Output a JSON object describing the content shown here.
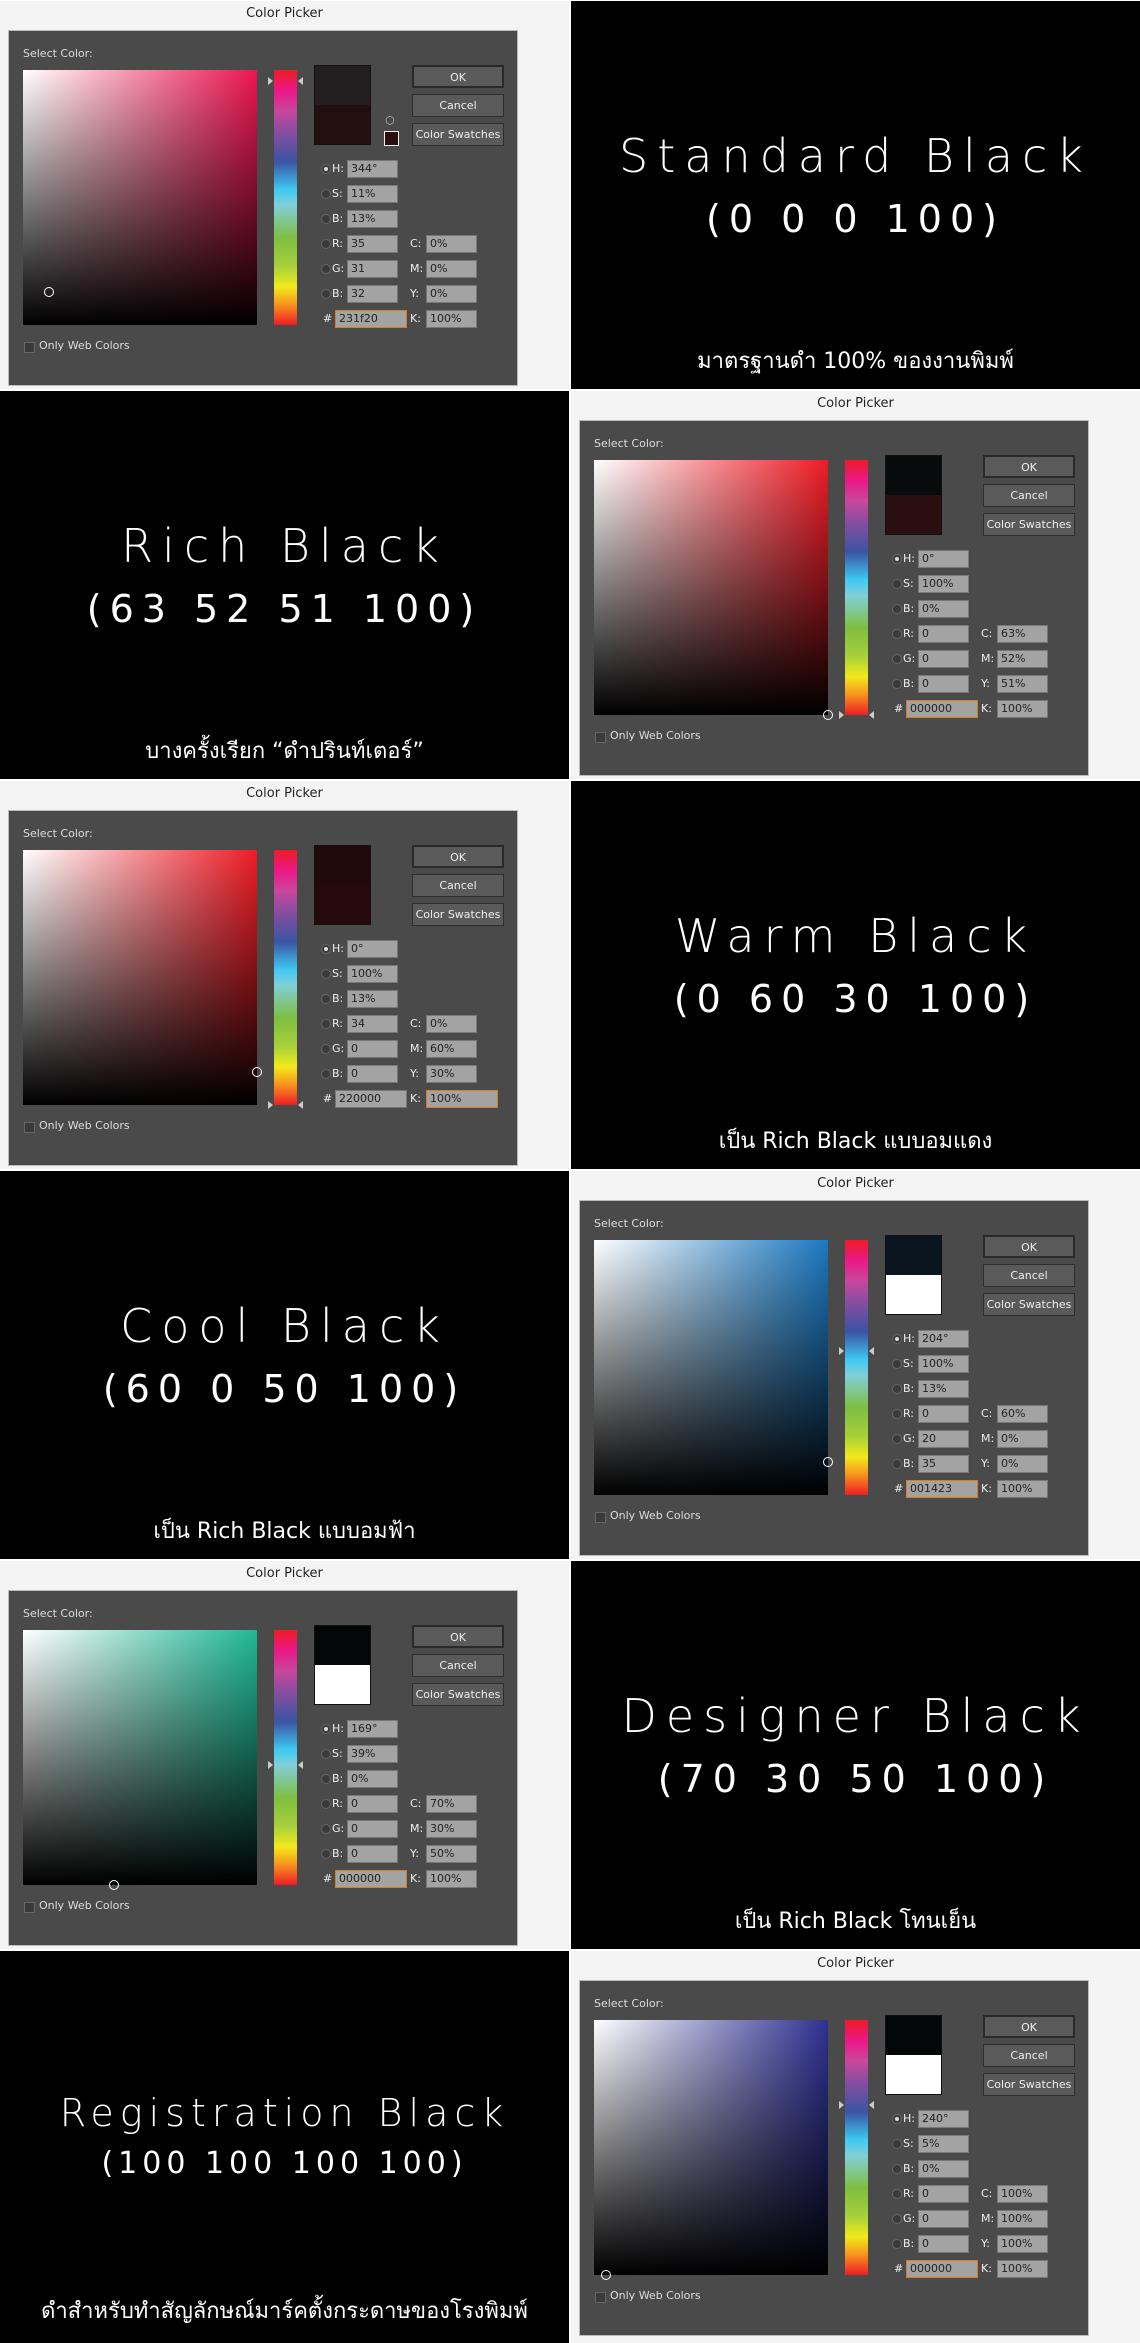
{
  "dialog_common": {
    "title": "Color Picker",
    "select_label": "Select Color:",
    "ok": "OK",
    "cancel": "Cancel",
    "swatches": "Color Swatches",
    "only_web": "Only Web Colors",
    "labels": {
      "h": "H:",
      "s": "S:",
      "b": "B:",
      "r": "R:",
      "g": "G:",
      "bl": "B:",
      "hex": "#",
      "c": "C:",
      "m": "M:",
      "y": "Y:",
      "k": "K:"
    }
  },
  "rows": [
    {
      "dialog_side": "left",
      "dialog": {
        "h": "344°",
        "s": "11%",
        "b": "13%",
        "r": "35",
        "g": "31",
        "bl": "32",
        "hex": "231f20",
        "c": "0%",
        "m": "0%",
        "y": "0%",
        "k": "100%",
        "hue_deg": 344,
        "sat": 0.11,
        "bri": 0.13,
        "new_color": "#231f20",
        "old_color": "#230e10",
        "hue_color": "#ec1550",
        "selected_field": "hex"
      },
      "text": {
        "title": "Standard Black",
        "values": "(0 0 0 100)",
        "caption": "มาตรฐานดำ 100% ของงานพิมพ์"
      }
    },
    {
      "dialog_side": "right",
      "dialog": {
        "h": "0°",
        "s": "100%",
        "b": "0%",
        "r": "0",
        "g": "0",
        "bl": "0",
        "hex": "000000",
        "c": "63%",
        "m": "52%",
        "y": "51%",
        "k": "100%",
        "hue_deg": 0,
        "sat": 1,
        "bri": 0,
        "new_color": "#070b0c",
        "old_color": "#2a0e10",
        "hue_color": "#ee1c25",
        "selected_field": "hex"
      },
      "text": {
        "title": "Rich Black",
        "values": "(63 52 51 100)",
        "caption": "บางครั้งเรียก “ดำปรินท์เตอร์”"
      }
    },
    {
      "dialog_side": "left",
      "dialog": {
        "h": "0°",
        "s": "100%",
        "b": "13%",
        "r": "34",
        "g": "0",
        "bl": "0",
        "hex": "220000",
        "c": "0%",
        "m": "60%",
        "y": "30%",
        "k": "100%",
        "hue_deg": 0,
        "sat": 1,
        "bri": 0.13,
        "new_color": "#220a0c",
        "old_color": "#26090c",
        "hue_color": "#ee1c25",
        "selected_field": "k"
      },
      "text": {
        "title": "Warm Black",
        "values": "(0 60 30 100)",
        "caption": "เป็น Rich Black แบบอมแดง"
      }
    },
    {
      "dialog_side": "right",
      "dialog": {
        "h": "204°",
        "s": "100%",
        "b": "13%",
        "r": "0",
        "g": "20",
        "bl": "35",
        "hex": "001423",
        "c": "60%",
        "m": "0%",
        "y": "0%",
        "k": "100%",
        "hue_deg": 204,
        "sat": 1,
        "bri": 0.13,
        "new_color": "#0b1520",
        "old_color": "#ffffff",
        "hue_color": "#1c78c0",
        "selected_field": "hex"
      },
      "text": {
        "title": "Cool Black",
        "values": "(60 0 50 100)",
        "caption": "เป็น Rich Black แบบอมฟ้า"
      }
    },
    {
      "dialog_side": "left",
      "dialog": {
        "h": "169°",
        "s": "39%",
        "b": "0%",
        "r": "0",
        "g": "0",
        "bl": "0",
        "hex": "000000",
        "c": "70%",
        "m": "30%",
        "y": "50%",
        "k": "100%",
        "hue_deg": 169,
        "sat": 0.39,
        "bri": 0,
        "new_color": "#030707",
        "old_color": "#ffffff",
        "hue_color": "#1fb894",
        "selected_field": "hex"
      },
      "text": {
        "title": "Designer Black",
        "values": "(70 30 50 100)",
        "caption": "เป็น Rich Black โทนเย็น"
      }
    },
    {
      "dialog_side": "right",
      "dialog": {
        "h": "240°",
        "s": "5%",
        "b": "0%",
        "r": "0",
        "g": "0",
        "bl": "0",
        "hex": "000000",
        "c": "100%",
        "m": "100%",
        "y": "100%",
        "k": "100%",
        "hue_deg": 240,
        "sat": 0.05,
        "bri": 0,
        "new_color": "#030707",
        "old_color": "#ffffff",
        "hue_color": "#2e3192",
        "selected_field": "hex"
      },
      "text": {
        "title": "Registration Black",
        "values": "(100 100 100 100)",
        "caption": "ดำสำหรับทำสัญลักษณ์มาร์คตั้งกระดาษของโรงพิมพ์"
      }
    }
  ]
}
